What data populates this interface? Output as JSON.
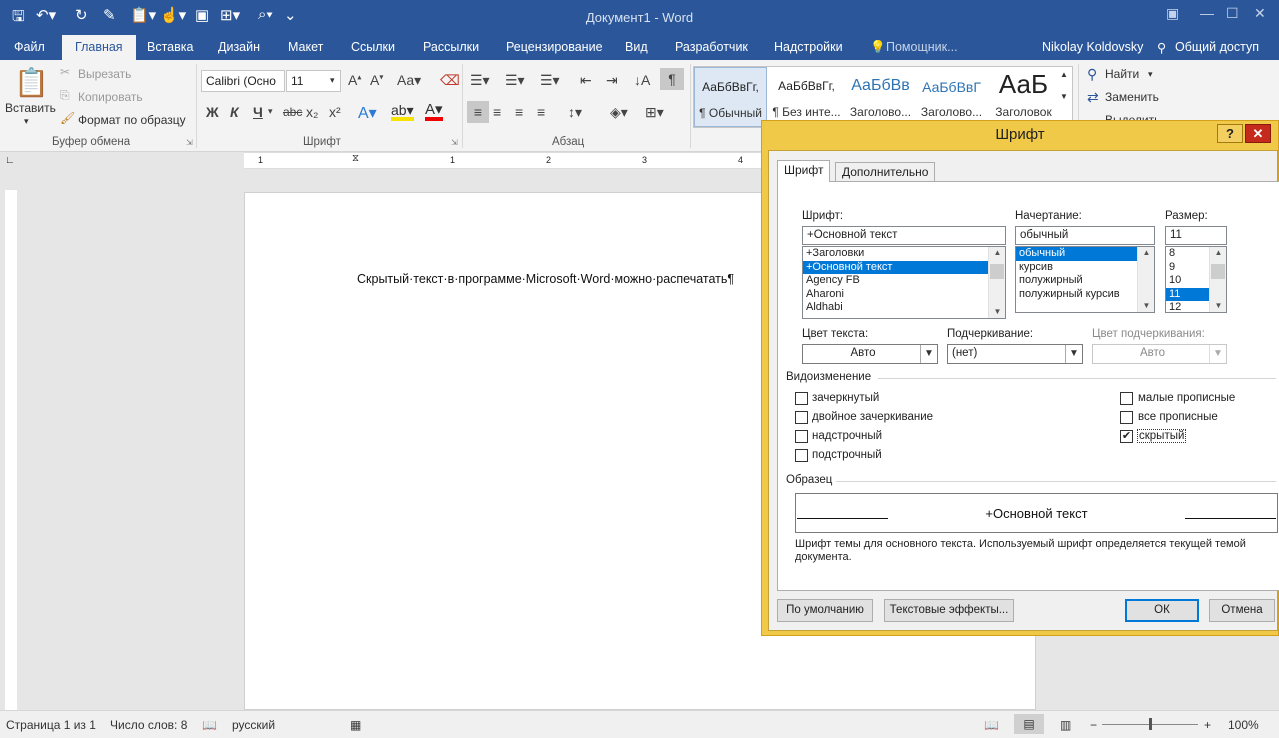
{
  "window": {
    "title": "Документ1 - Word"
  },
  "tabs": [
    "Файл",
    "Главная",
    "Вставка",
    "Дизайн",
    "Макет",
    "Ссылки",
    "Рассылки",
    "Рецензирование",
    "Вид",
    "Разработчик",
    "Надстройки",
    "Помощник..."
  ],
  "user": {
    "name": "Nikolay Koldovsky",
    "share": "Общий доступ"
  },
  "clipboard": {
    "paste": "Вставить",
    "cut": "Вырезать",
    "copy": "Копировать",
    "format_painter": "Формат по образцу",
    "group": "Буфер обмена"
  },
  "font": {
    "name": "Calibri (Осно",
    "size": "11",
    "group": "Шрифт",
    "case": "Aa",
    "bold": "Ж",
    "italic": "К",
    "underline": "Ч",
    "strike": "abc",
    "sub": "x₂",
    "sup": "x²"
  },
  "paragraph": {
    "group": "Абзац"
  },
  "styles": [
    {
      "preview": "АаБбВвГг,",
      "name": "¶ Обычный"
    },
    {
      "preview": "АаБбВвГг,",
      "name": "¶ Без инте..."
    },
    {
      "preview": "АаБбВв",
      "name": "Заголово..."
    },
    {
      "preview": "АаБбВвГ",
      "name": "Заголово..."
    },
    {
      "preview": "АаБ",
      "name": "Заголовок"
    }
  ],
  "editing": {
    "find": "Найти",
    "replace": "Заменить",
    "select": "Выделить"
  },
  "ruler": {
    "marks": [
      "1",
      "1",
      "2",
      "3",
      "4"
    ]
  },
  "document": {
    "text": "Скрытый·текст·в·программе·Microsoft·Word·можно·распечатать¶"
  },
  "status": {
    "page": "Страница 1 из 1",
    "words": "Число слов: 8",
    "language": "русский",
    "zoom": "100%"
  },
  "dialog": {
    "title": "Шрифт",
    "help": "?",
    "close": "✕",
    "tab_font": "Шрифт",
    "tab_advanced": "Дополнительно",
    "font_label": "Шрифт:",
    "font_value": "+Основной текст",
    "font_list": [
      "+Заголовки",
      "+Основной текст",
      "Agency FB",
      "Aharoni",
      "Aldhabi"
    ],
    "style_label": "Начертание:",
    "style_value": "обычный",
    "style_list": [
      "обычный",
      "курсив",
      "полужирный",
      "полужирный курсив"
    ],
    "size_label": "Размер:",
    "size_value": "11",
    "size_list": [
      "8",
      "9",
      "10",
      "11",
      "12"
    ],
    "color_label": "Цвет текста:",
    "color_value": "Авто",
    "underline_label": "Подчеркивание:",
    "underline_value": "(нет)",
    "ucolor_label": "Цвет подчеркивания:",
    "ucolor_value": "Авто",
    "effects_label": "Видоизменение",
    "effects_left": [
      {
        "label": "зачеркнутый",
        "checked": false
      },
      {
        "label": "двойное зачеркивание",
        "checked": false
      },
      {
        "label": "надстрочный",
        "checked": false
      },
      {
        "label": "подстрочный",
        "checked": false
      }
    ],
    "effects_right": [
      {
        "label": "малые прописные",
        "checked": false
      },
      {
        "label": "все прописные",
        "checked": false
      },
      {
        "label": "скрытый",
        "checked": true
      }
    ],
    "preview_label": "Образец",
    "preview_text": "+Основной текст",
    "description": "Шрифт темы для основного текста. Используемый шрифт определяется текущей темой документа.",
    "btn_default": "По умолчанию",
    "btn_effects": "Текстовые эффекты...",
    "btn_ok": "ОК",
    "btn_cancel": "Отмена"
  }
}
